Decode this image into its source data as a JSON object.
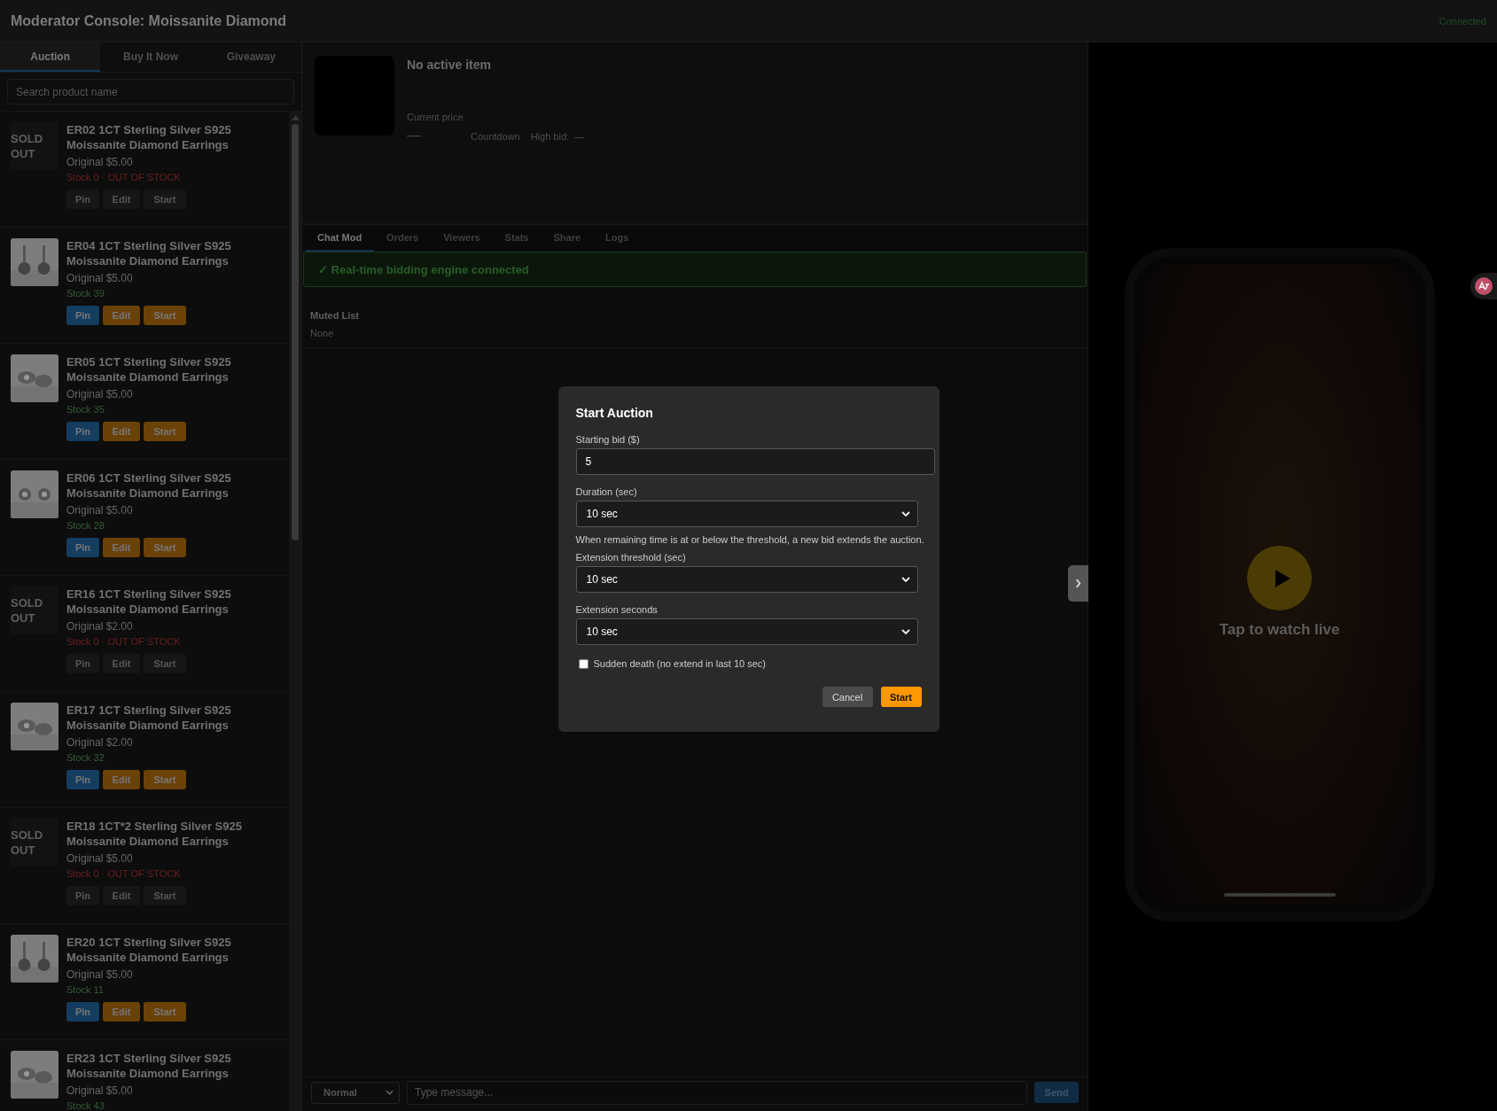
{
  "header": {
    "title": "Moderator Console: Moissanite Diamond",
    "status": "Connected"
  },
  "sidebar": {
    "tabs": [
      {
        "label": "Auction",
        "selected": true
      },
      {
        "label": "Buy It Now",
        "selected": false
      },
      {
        "label": "Giveaway",
        "selected": false
      }
    ],
    "search": {
      "placeholder": "Search product name"
    },
    "products": [
      {
        "title": "ER02 1CT Sterling Silver S925 Moissanite Diamond Earrings",
        "price": "Original $5.00",
        "stock": "Stock 0 · OUT OF STOCK",
        "sold_out": true,
        "sold_label": "SOLD OUT",
        "actions": [
          {
            "label": "Pin",
            "kind": "pin",
            "disabled": true
          },
          {
            "label": "Edit",
            "kind": "edit",
            "disabled": true
          },
          {
            "label": "Start",
            "kind": "start",
            "disabled": true
          }
        ]
      },
      {
        "title": "ER04 1CT Sterling Silver S925 Moissanite Diamond Earrings",
        "price": "Original $5.00",
        "stock": "Stock 39",
        "sold_out": false,
        "actions": [
          {
            "label": "Pin",
            "kind": "pin",
            "disabled": false
          },
          {
            "label": "Edit",
            "kind": "edit",
            "disabled": false
          },
          {
            "label": "Start",
            "kind": "start",
            "disabled": false
          }
        ]
      },
      {
        "title": "ER05 1CT Sterling Silver S925 Moissanite Diamond Earrings",
        "price": "Original $5.00",
        "stock": "Stock 35",
        "sold_out": false,
        "actions": [
          {
            "label": "Pin",
            "kind": "pin",
            "disabled": false
          },
          {
            "label": "Edit",
            "kind": "edit",
            "disabled": false
          },
          {
            "label": "Start",
            "kind": "start",
            "disabled": false
          }
        ]
      },
      {
        "title": "ER06 1CT Sterling Silver S925 Moissanite Diamond Earrings",
        "price": "Original $5.00",
        "stock": "Stock 28",
        "sold_out": false,
        "actions": [
          {
            "label": "Pin",
            "kind": "pin",
            "disabled": false
          },
          {
            "label": "Edit",
            "kind": "edit",
            "disabled": false
          },
          {
            "label": "Start",
            "kind": "start",
            "disabled": false
          }
        ]
      },
      {
        "title": "ER16 1CT Sterling Silver S925 Moissanite Diamond Earrings",
        "price": "Original $2.00",
        "stock": "Stock 0 · OUT OF STOCK",
        "sold_out": true,
        "sold_label": "SOLD OUT",
        "actions": [
          {
            "label": "Pin",
            "kind": "pin",
            "disabled": true
          },
          {
            "label": "Edit",
            "kind": "edit",
            "disabled": true
          },
          {
            "label": "Start",
            "kind": "start",
            "disabled": true
          }
        ]
      },
      {
        "title": "ER17 1CT Sterling Silver S925 Moissanite Diamond Earrings",
        "price": "Original $2.00",
        "stock": "Stock 32",
        "sold_out": false,
        "actions": [
          {
            "label": "Pin",
            "kind": "pin",
            "disabled": false
          },
          {
            "label": "Edit",
            "kind": "edit",
            "disabled": false
          },
          {
            "label": "Start",
            "kind": "start",
            "disabled": false
          }
        ]
      },
      {
        "title": "ER18 1CT*2 Sterling Silver S925 Moissanite Diamond Earrings",
        "price": "Original $5.00",
        "stock": "Stock 0 · OUT OF STOCK",
        "sold_out": true,
        "sold_label": "SOLD OUT",
        "actions": [
          {
            "label": "Pin",
            "kind": "pin",
            "disabled": true
          },
          {
            "label": "Edit",
            "kind": "edit",
            "disabled": true
          },
          {
            "label": "Start",
            "kind": "start",
            "disabled": true
          }
        ]
      },
      {
        "title": "ER20 1CT Sterling Silver S925 Moissanite Diamond Earrings",
        "price": "Original $5.00",
        "stock": "Stock 11",
        "sold_out": false,
        "actions": [
          {
            "label": "Pin",
            "kind": "pin",
            "disabled": false
          },
          {
            "label": "Edit",
            "kind": "edit",
            "disabled": false
          },
          {
            "label": "Start",
            "kind": "start",
            "disabled": false
          }
        ]
      },
      {
        "title": "ER23 1CT Sterling Silver S925 Moissanite Diamond Earrings",
        "price": "Original $5.00",
        "stock": "Stock 43",
        "sold_out": false
      }
    ]
  },
  "current": {
    "title": "No active item",
    "price_label": "Current price",
    "price": "—",
    "countdown_label": "Countdown",
    "high_bid_label": "High bid:",
    "high_bid": "—"
  },
  "tabs": [
    {
      "label": "Chat Mod",
      "selected": true
    },
    {
      "label": "Orders",
      "selected": false
    },
    {
      "label": "Viewers",
      "selected": false
    },
    {
      "label": "Stats",
      "selected": false
    },
    {
      "label": "Share",
      "selected": false
    },
    {
      "label": "Logs",
      "selected": false
    }
  ],
  "banner": "✓ Real-time bidding engine connected",
  "muted": {
    "title": "Muted List",
    "value": "None"
  },
  "composer": {
    "mode": "Normal",
    "placeholder": "Type message...",
    "send": "Send"
  },
  "preview": {
    "caption": "Tap to watch live"
  },
  "modal": {
    "title": "Start Auction",
    "fields": [
      {
        "kind": "input",
        "label": "Starting bid ($)",
        "value": "5"
      },
      {
        "kind": "select",
        "label": "Duration (sec)",
        "value": "10 sec"
      },
      {
        "kind": "note",
        "text": "When remaining time is at or below the threshold, a new bid extends the auction."
      },
      {
        "kind": "select",
        "label": "Extension threshold (sec)",
        "value": "10 sec"
      },
      {
        "kind": "select",
        "label": "Extension seconds",
        "value": "10 sec"
      },
      {
        "kind": "checkbox",
        "label": "Sudden death (no extend in last 10 sec)",
        "checked": false
      }
    ],
    "buttons": [
      {
        "label": "Cancel",
        "kind": "secondary"
      },
      {
        "label": "Start",
        "kind": "primary"
      }
    ]
  }
}
